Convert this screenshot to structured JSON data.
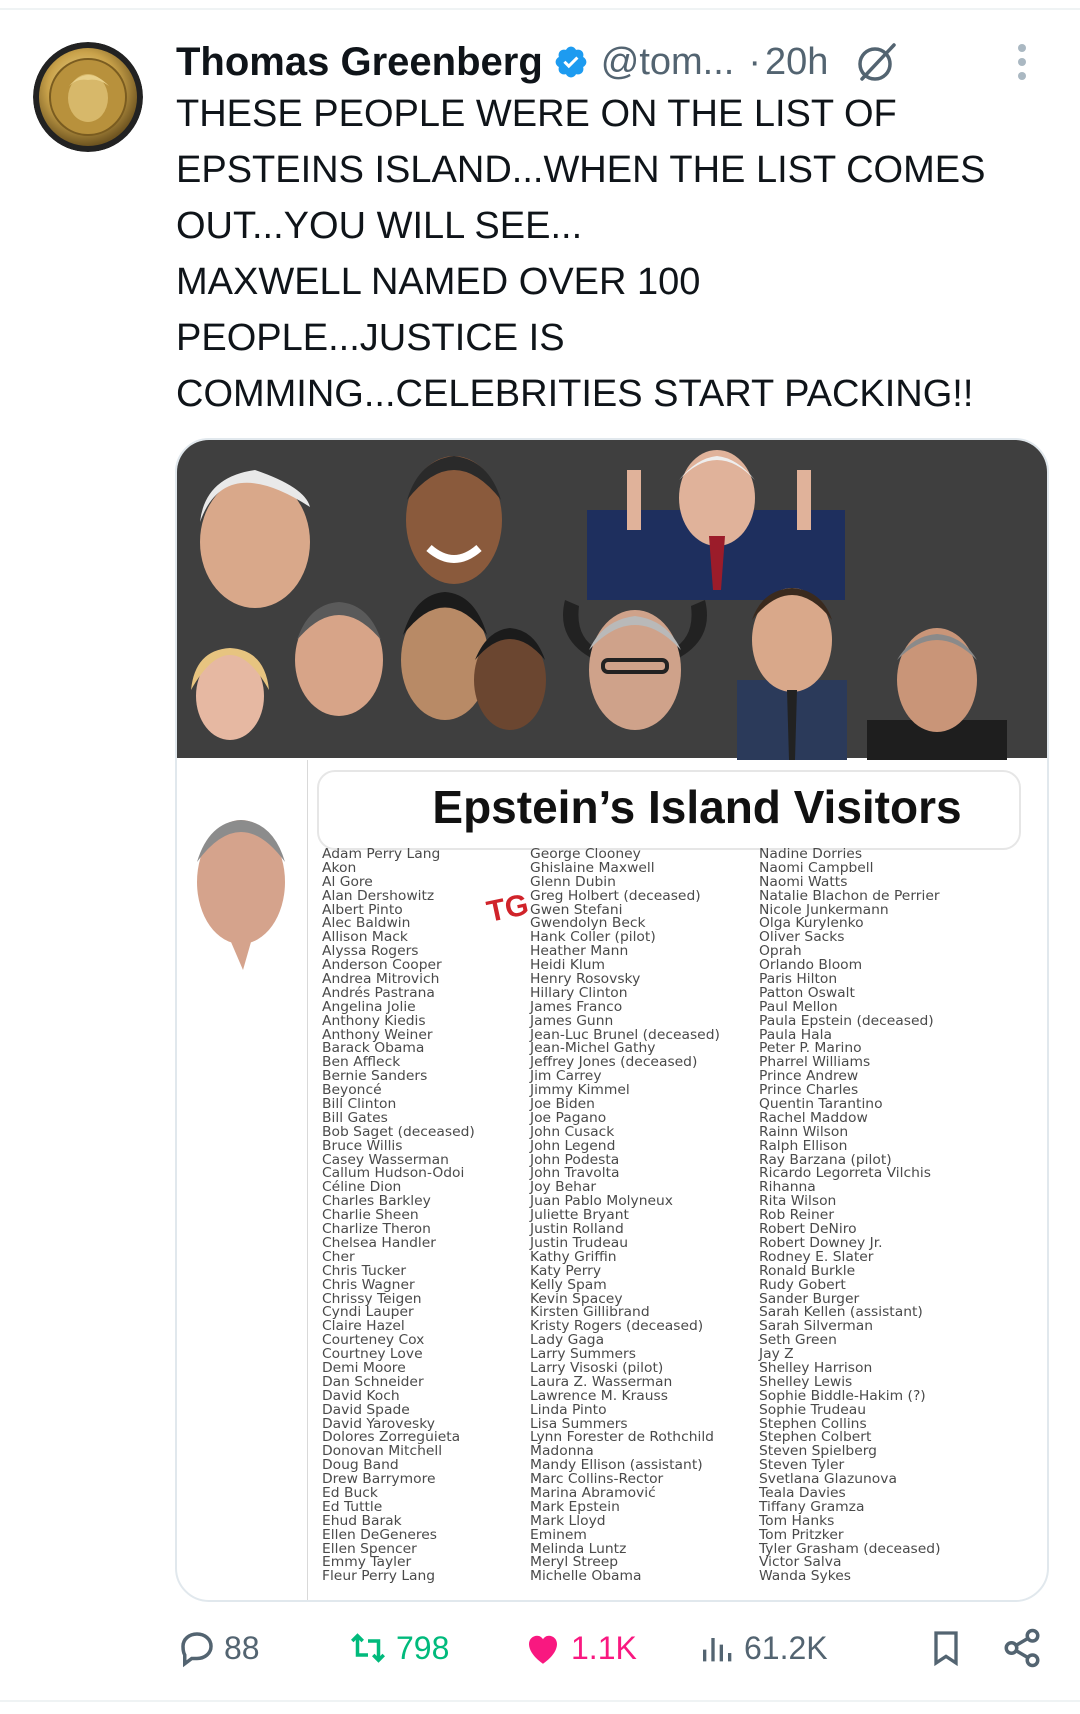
{
  "colors": {
    "text": "#0f1419",
    "muted": "#536471",
    "verified_blue": "#1d9bf0",
    "repost_green": "#00ba7c",
    "like_pink": "#f91880",
    "tg_red": "#d0232a"
  },
  "post": {
    "author_name": "Thomas Greenberg",
    "handle": "@tom...",
    "separator": "·",
    "time": "20h",
    "text_lines": [
      "THESE PEOPLE WERE ON THE LIST OF",
      "EPSTEINS ISLAND...WHEN THE LIST COMES",
      "OUT...YOU WILL SEE...",
      "MAXWELL NAMED OVER 100",
      "PEOPLE...JUSTICE IS",
      "COMMING...CELEBRITIES START PACKING!!"
    ],
    "icons": {
      "verified": "verified-badge-icon",
      "grok": "grok-icon",
      "more": "more-options-icon"
    }
  },
  "media": {
    "title": "Epstein’s Island Visitors",
    "tg_mark": "TG",
    "columns": [
      [
        "Adam Perry Lang",
        "Akon",
        "Al Gore",
        "Alan Dershowitz",
        "Albert Pinto",
        "Alec Baldwin",
        "Allison Mack",
        "Alyssa Rogers",
        "Anderson Cooper",
        "Andrea Mitrovich",
        "Andrés Pastrana",
        "Angelina Jolie",
        "Anthony Kiedis",
        "Anthony Weiner",
        "Barack Obama",
        "Ben Affleck",
        "Bernie Sanders",
        "Beyoncé",
        "Bill Clinton",
        "Bill Gates",
        "Bob Saget (deceased)",
        "Bruce Willis",
        "Casey Wasserman",
        "Callum Hudson-Odoi",
        "Céline Dion",
        "Charles Barkley",
        "Charlie Sheen",
        "Charlize Theron",
        "Chelsea Handler",
        "Cher",
        "Chris Tucker",
        "Chris Wagner",
        "Chrissy Teigen",
        "Cyndi Lauper",
        "Claire Hazel",
        "Courteney Cox",
        "Courtney Love",
        "Demi Moore",
        "Dan Schneider",
        "David Koch",
        "David Spade",
        "David Yarovesky",
        "Dolores Zorreguieta",
        "Donovan Mitchell",
        "Doug Band",
        "Drew Barrymore",
        "Ed Buck",
        "Ed Tuttle",
        "Ehud Barak",
        "Ellen DeGeneres",
        "Ellen Spencer",
        "Emmy Tayler",
        "Fleur Perry Lang"
      ],
      [
        "George Clooney",
        "Ghislaine Maxwell",
        "Glenn Dubin",
        "Greg Holbert (deceased)",
        "Gwen Stefani",
        "Gwendolyn Beck",
        "Hank Coller (pilot)",
        "Heather Mann",
        "Heidi Klum",
        "Henry Rosovsky",
        "Hillary Clinton",
        "James Franco",
        "James Gunn",
        "Jean-Luc Brunel (deceased)",
        "Jean-Michel Gathy",
        "Jeffrey Jones (deceased)",
        "Jim Carrey",
        "Jimmy Kimmel",
        "Joe Biden",
        "Joe Pagano",
        "John Cusack",
        "John Legend",
        "John Podesta",
        "John Travolta",
        "Joy Behar",
        "Juan Pablo Molyneux",
        "Juliette Bryant",
        "Justin Rolland",
        "Justin Trudeau",
        "Kathy Griffin",
        "Katy Perry",
        "Kelly Spam",
        "Kevin Spacey",
        "Kirsten Gillibrand",
        "Kristy Rogers (deceased)",
        "Lady Gaga",
        "Larry Summers",
        "Larry Visoski (pilot)",
        "Laura Z. Wasserman",
        "Lawrence M. Krauss",
        "Linda Pinto",
        "Lisa Summers",
        "Lynn Forester de Rothchild",
        "Madonna",
        "Mandy Ellison (assistant)",
        "Marc Collins-Rector",
        "Marina Abramović",
        "Mark Epstein",
        "Mark Lloyd",
        "Eminem",
        "Melinda Luntz",
        "Meryl Streep",
        "Michelle Obama"
      ],
      [
        "Nadine Dorries",
        "Naomi Campbell",
        "Naomi Watts",
        "Natalie Blachon de Perrier",
        "Nicole Junkermann",
        "Olga Kurylenko",
        "Oliver Sacks",
        "Oprah",
        "Orlando Bloom",
        "Paris Hilton",
        "Patton Oswalt",
        "Paul Mellon",
        "Paula Epstein (deceased)",
        "Paula Hala",
        "Peter P. Marino",
        "Pharrel Williams",
        "Prince Andrew",
        "Prince Charles",
        "Quentin Tarantino",
        "Rachel Maddow",
        "Rainn Wilson",
        "Ralph Ellison",
        "Ray Barzana (pilot)",
        "Ricardo Legorreta Vilchis",
        "Rihanna",
        "Rita Wilson",
        "Rob Reiner",
        "Robert DeNiro",
        "Robert Downey Jr.",
        "Rodney E. Slater",
        "Ronald Burkle",
        "Rudy Gobert",
        "Sander Burger",
        "Sarah Kellen (assistant)",
        "Sarah Silverman",
        "Seth Green",
        "Jay Z",
        "Shelley Harrison",
        "Shelley Lewis",
        "Sophie Biddle-Hakim (?)",
        "Sophie Trudeau",
        "Stephen Collins",
        "Stephen Colbert",
        "Steven Spielberg",
        "Steven Tyler",
        "Svetlana Glazunova",
        "Teala Davies",
        "Tiffany Gramza",
        "Tom Hanks",
        "Tom Pritzker",
        "Tyler Grasham (deceased)",
        "Victor Salva",
        "Wanda Sykes"
      ]
    ]
  },
  "actions": {
    "replies": "88",
    "reposts": "798",
    "likes": "1.1K",
    "views": "61.2K"
  }
}
